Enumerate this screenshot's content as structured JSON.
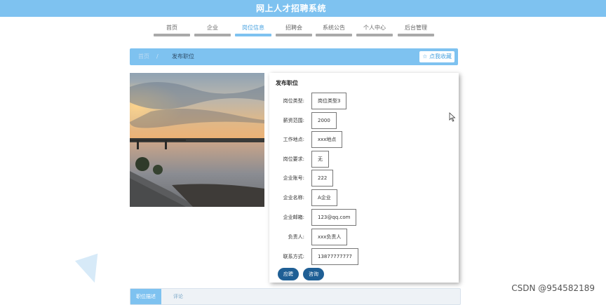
{
  "header": {
    "title": "网上人才招聘系统"
  },
  "nav": {
    "items": [
      {
        "label": "首页",
        "active": false
      },
      {
        "label": "企业",
        "active": false
      },
      {
        "label": "岗位信息",
        "active": true
      },
      {
        "label": "招聘会",
        "active": false
      },
      {
        "label": "系统公告",
        "active": false
      },
      {
        "label": "个人中心",
        "active": false
      },
      {
        "label": "后台管理",
        "active": false
      }
    ]
  },
  "breadcrumb": {
    "home": "首页",
    "separator": "/",
    "current": "发布职位"
  },
  "favorite_button": {
    "icon": "star-icon",
    "label": "☆ 点我收藏"
  },
  "detail": {
    "title": "发布职位",
    "fields": [
      {
        "label": "岗位类型:",
        "value": "岗位类型3"
      },
      {
        "label": "薪资范围:",
        "value": "2000"
      },
      {
        "label": "工作地点:",
        "value": "xxx地点"
      },
      {
        "label": "岗位要求:",
        "value": "无"
      },
      {
        "label": "企业账号:",
        "value": "222"
      },
      {
        "label": "企业名称:",
        "value": "A企业"
      },
      {
        "label": "企业邮箱:",
        "value": "123@qq.com"
      },
      {
        "label": "负责人:",
        "value": "xxx负责人"
      },
      {
        "label": "联系方式:",
        "value": "13877777777"
      }
    ],
    "apply_label": "应聘",
    "consult_label": "咨询"
  },
  "tabs": [
    {
      "label": "职位描述",
      "active": true
    },
    {
      "label": "评论",
      "active": false
    }
  ],
  "watermark": "CSDN @954582189",
  "colors": {
    "accent": "#7ec2f0",
    "button": "#1f5f95"
  }
}
